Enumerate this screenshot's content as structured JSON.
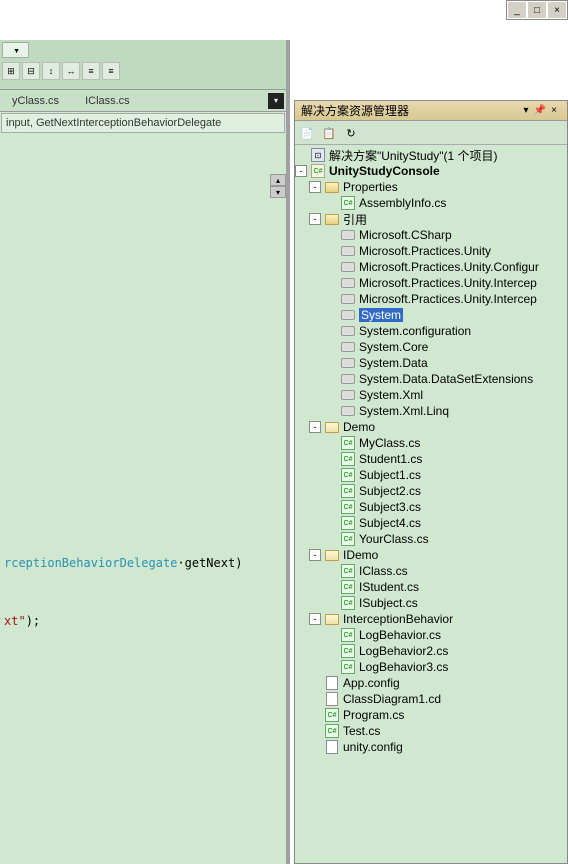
{
  "windowControls": [
    "_",
    "□",
    "×"
  ],
  "tabs": [
    "yClass.cs",
    "IClass.cs"
  ],
  "methodDropdown": " input, GetNextInterceptionBehaviorDelegate",
  "codeSnippet1_class": "rceptionBehaviorDelegate",
  "codeSnippet1_sep": "·",
  "codeSnippet1_method": "getNext)",
  "codeSnippet2_str": "xt\"",
  "codeSnippet2_rest": ");",
  "panelTitle": "解决方案资源管理器",
  "solution": {
    "label": "解决方案\"UnityStudy\"(1 个项目)",
    "project": "UnityStudyConsole",
    "folders": {
      "properties": {
        "label": "Properties",
        "items": [
          "AssemblyInfo.cs"
        ]
      },
      "references": {
        "label": "引用",
        "items": [
          "Microsoft.CSharp",
          "Microsoft.Practices.Unity",
          "Microsoft.Practices.Unity.Configur",
          "Microsoft.Practices.Unity.Intercep",
          "Microsoft.Practices.Unity.Intercep",
          "System",
          "System.configuration",
          "System.Core",
          "System.Data",
          "System.Data.DataSetExtensions",
          "System.Xml",
          "System.Xml.Linq"
        ],
        "selectedIndex": 5
      },
      "demo": {
        "label": "Demo",
        "items": [
          "MyClass.cs",
          "Student1.cs",
          "Subject1.cs",
          "Subject2.cs",
          "Subject3.cs",
          "Subject4.cs",
          "YourClass.cs"
        ]
      },
      "idemo": {
        "label": "IDemo",
        "items": [
          "IClass.cs",
          "IStudent.cs",
          "ISubject.cs"
        ]
      },
      "interception": {
        "label": "InterceptionBehavior",
        "items": [
          "LogBehavior.cs",
          "LogBehavior2.cs",
          "LogBehavior3.cs"
        ]
      }
    },
    "rootFiles": [
      {
        "name": "App.config",
        "type": "cfg"
      },
      {
        "name": "ClassDiagram1.cd",
        "type": "cd"
      },
      {
        "name": "Program.cs",
        "type": "cs"
      },
      {
        "name": "Test.cs",
        "type": "cs"
      },
      {
        "name": "unity.config",
        "type": "cfg"
      }
    ]
  }
}
